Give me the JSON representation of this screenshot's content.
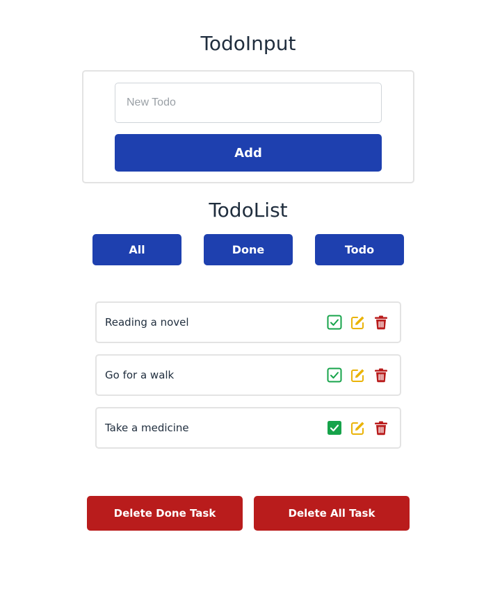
{
  "input_section": {
    "title": "TodoInput",
    "placeholder": "New Todo",
    "value": "",
    "add_label": "Add"
  },
  "list_section": {
    "title": "TodoList",
    "filters": [
      {
        "label": "All"
      },
      {
        "label": "Done"
      },
      {
        "label": "Todo"
      }
    ],
    "tasks": [
      {
        "text": "Reading a novel",
        "done": false
      },
      {
        "text": "Go for a walk",
        "done": false
      },
      {
        "text": "Take a medicine",
        "done": true
      }
    ]
  },
  "actions": {
    "delete_done_label": "Delete Done Task",
    "delete_all_label": "Delete All Task"
  },
  "colors": {
    "primary": "#1e40af",
    "danger": "#b91c1c",
    "check": "#16a34a",
    "edit": "#eab308",
    "delete": "#b91c1c"
  },
  "icons": {
    "check": "square-check-icon",
    "edit": "pen-to-square-icon",
    "delete": "trash-can-icon"
  }
}
